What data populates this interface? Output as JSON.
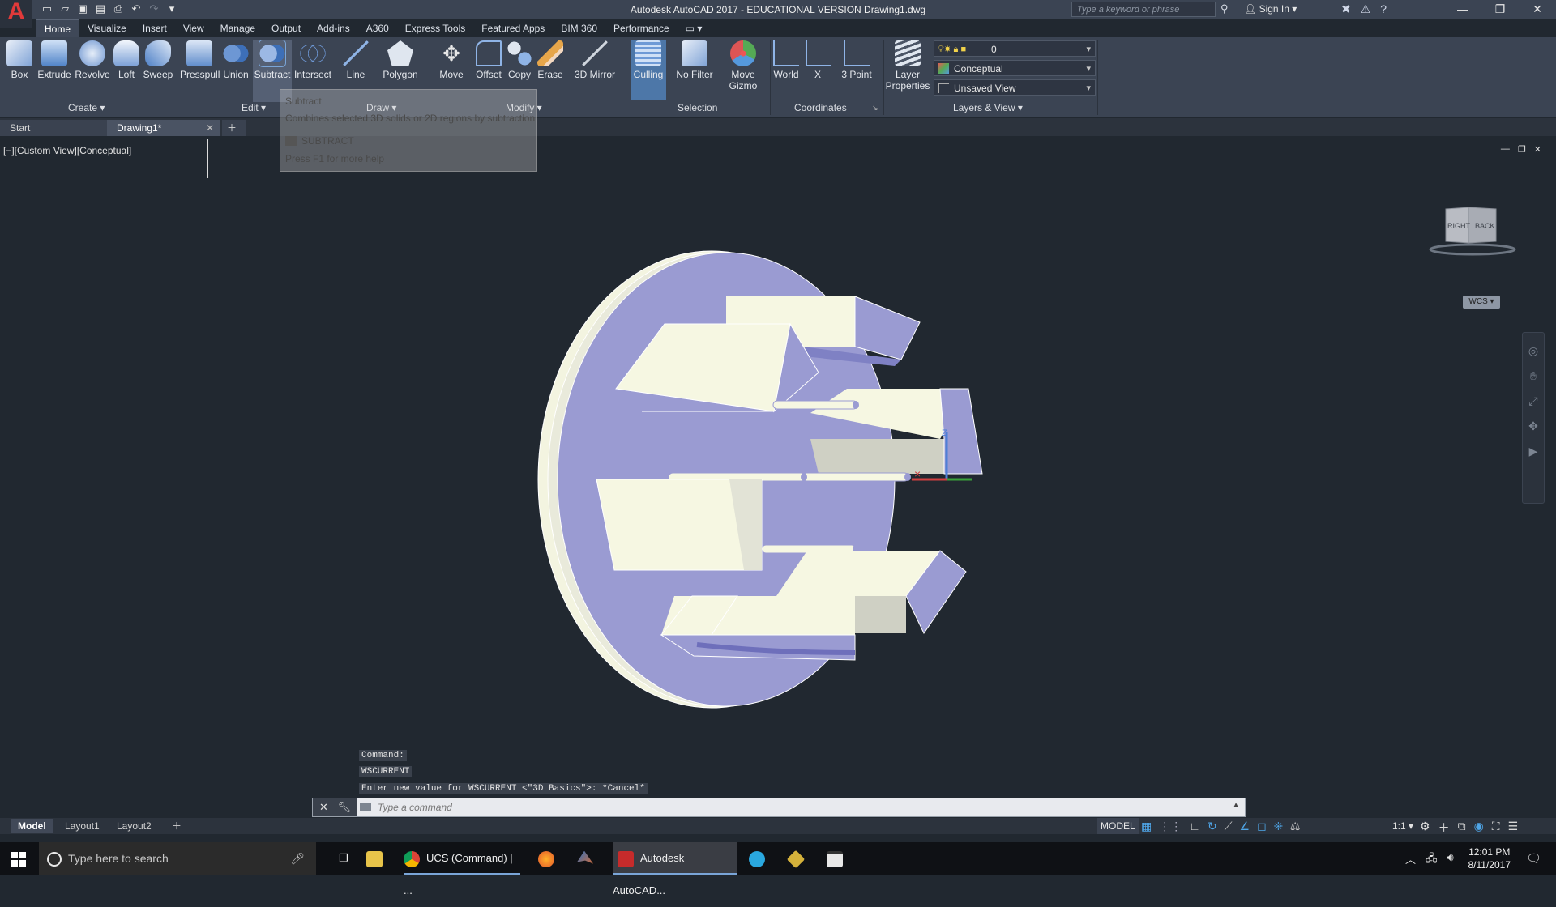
{
  "titlebar": {
    "title": "Autodesk AutoCAD 2017 - EDUCATIONAL VERSION    Drawing1.dwg",
    "search_placeholder": "Type a keyword or phrase",
    "sign_in": "Sign In",
    "app_letter": "A"
  },
  "ribbon_tabs": [
    "Home",
    "Visualize",
    "Insert",
    "View",
    "Manage",
    "Output",
    "Add-ins",
    "A360",
    "Express Tools",
    "Featured Apps",
    "BIM 360",
    "Performance"
  ],
  "ribbon": {
    "create": {
      "label": "Create",
      "buttons": [
        "Box",
        "Extrude",
        "Revolve",
        "Loft",
        "Sweep"
      ]
    },
    "edit": {
      "label": "Edit",
      "buttons": [
        "Presspull",
        "Union",
        "Subtract",
        "Intersect"
      ]
    },
    "draw": {
      "label": "Draw",
      "buttons": [
        "Line",
        "Polygon"
      ]
    },
    "modify": {
      "label": "Modify",
      "buttons": [
        "Move",
        "Offset",
        "Copy",
        "Erase",
        "3D Mirror"
      ]
    },
    "selection": {
      "label": "Selection",
      "buttons": [
        "Culling",
        "No Filter",
        "Move Gizmo"
      ]
    },
    "coordinates": {
      "label": "Coordinates",
      "buttons": [
        "World",
        "X",
        "3 Point"
      ]
    },
    "layers": {
      "label": "Layers & View",
      "button": "Layer Properties",
      "layer_value": "0",
      "visual_style": "Conceptual",
      "view": "Unsaved View"
    }
  },
  "doc_tabs": [
    "Start",
    "Drawing1*"
  ],
  "viewport": {
    "label": "[−][Custom View][Conceptual]",
    "viewcube_right": "RIGHT",
    "viewcube_back": "BACK",
    "wcs": "WCS",
    "colors": {
      "face": "#9a9bd2",
      "light": "#f6f7e2",
      "shade": "#cfd0c4",
      "edge": "#ffffff"
    }
  },
  "tooltip": {
    "title": "Subtract",
    "description": "Combines selected 3D solids or 2D regions by subtraction",
    "command": "SUBTRACT",
    "help": "Press F1 for more help"
  },
  "command": {
    "history": [
      "Command:",
      "WSCURRENT",
      "Enter new value for WSCURRENT <\"3D Basics\">: *Cancel*"
    ],
    "placeholder": "Type a command"
  },
  "layout_tabs": [
    "Model",
    "Layout1",
    "Layout2"
  ],
  "status": {
    "model": "MODEL",
    "scale": "1:1"
  },
  "taskbar": {
    "search": "Type here to search",
    "tasks": [
      "UCS (Command) | ...",
      "Autodesk AutoCAD..."
    ],
    "time": "12:01 PM",
    "date": "8/11/2017"
  }
}
